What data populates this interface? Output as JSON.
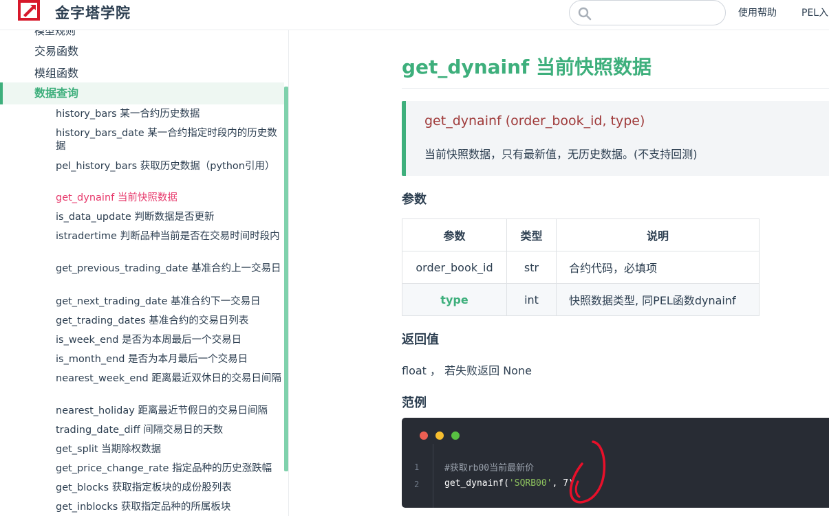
{
  "header": {
    "site_title": "金字塔学院",
    "search_placeholder": "",
    "nav": [
      "使用帮助",
      "PEL入"
    ]
  },
  "sidebar": {
    "cut_item": "模型规则",
    "groups": [
      "交易函数",
      "模组函数",
      "数据查询"
    ],
    "items": [
      {
        "name": "history_bars",
        "desc": "某一合约历史数据"
      },
      {
        "name": "history_bars_date",
        "desc": "某一合约指定时段内的历史数据"
      },
      {
        "name": "pel_history_bars",
        "desc": "获取历史数据（python引用）"
      },
      {
        "name": "get_dynainf",
        "desc": "当前快照数据"
      },
      {
        "name": "is_data_update",
        "desc": "判断数据是否更新"
      },
      {
        "name": "istradertime",
        "desc": "判断品种当前是否在交易时间时段内"
      },
      {
        "name": "get_previous_trading_date",
        "desc": "基准合约上一交易日"
      },
      {
        "name": "get_next_trading_date",
        "desc": "基准合约下一交易日"
      },
      {
        "name": "get_trading_dates",
        "desc": "基准合约的交易日列表"
      },
      {
        "name": "is_week_end",
        "desc": "是否为本周最后一个交易日"
      },
      {
        "name": "is_month_end",
        "desc": "是否为本月最后一个交易日"
      },
      {
        "name": "nearest_week_end",
        "desc": "距离最近双休日的交易日间隔"
      },
      {
        "name": "nearest_holiday",
        "desc": "距离最近节假日的交易日间隔"
      },
      {
        "name": "trading_date_diff",
        "desc": "间隔交易日的天数"
      },
      {
        "name": "get_split",
        "desc": "当期除权数据"
      },
      {
        "name": "get_price_change_rate",
        "desc": "指定品种的历史涨跌幅"
      },
      {
        "name": "get_blocks",
        "desc": "获取指定板块的成份股列表"
      },
      {
        "name": "get_inblocks",
        "desc": "获取指定品种的所属板块"
      }
    ],
    "active_index": 3
  },
  "main": {
    "title": "get_dynainf 当前快照数据",
    "signature": "get_dynainf (order_book_id, type)",
    "description": "当前快照数据，只有最新值，无历史数据。(不支持回测)",
    "params_heading": "参数",
    "table": {
      "headers": [
        "参数",
        "类型",
        "说明"
      ],
      "rows": [
        [
          "order_book_id",
          "str",
          "合约代码，必填项"
        ],
        [
          "type",
          "int",
          "快照数据类型, 同PEL函数dynainf"
        ]
      ]
    },
    "return_heading": "返回值",
    "return_text": "float ， 若失败返回 None",
    "example_heading": "范例",
    "code": {
      "line_numbers": [
        "1",
        "2"
      ],
      "comment": "#获取rb00当前最新价",
      "call_prefix": "get_dynainf(",
      "call_string": "'SQRB00'",
      "call_suffix": ", 7)"
    }
  },
  "colors": {
    "accent": "#3eaf7c",
    "active_link": "#e73a6c",
    "signature": "#9f3a3a",
    "code_bg": "#282c34",
    "dot_red": "#ec5f53",
    "dot_yellow": "#f6be2f",
    "dot_green": "#58c142",
    "annotation": "#e8102a"
  }
}
